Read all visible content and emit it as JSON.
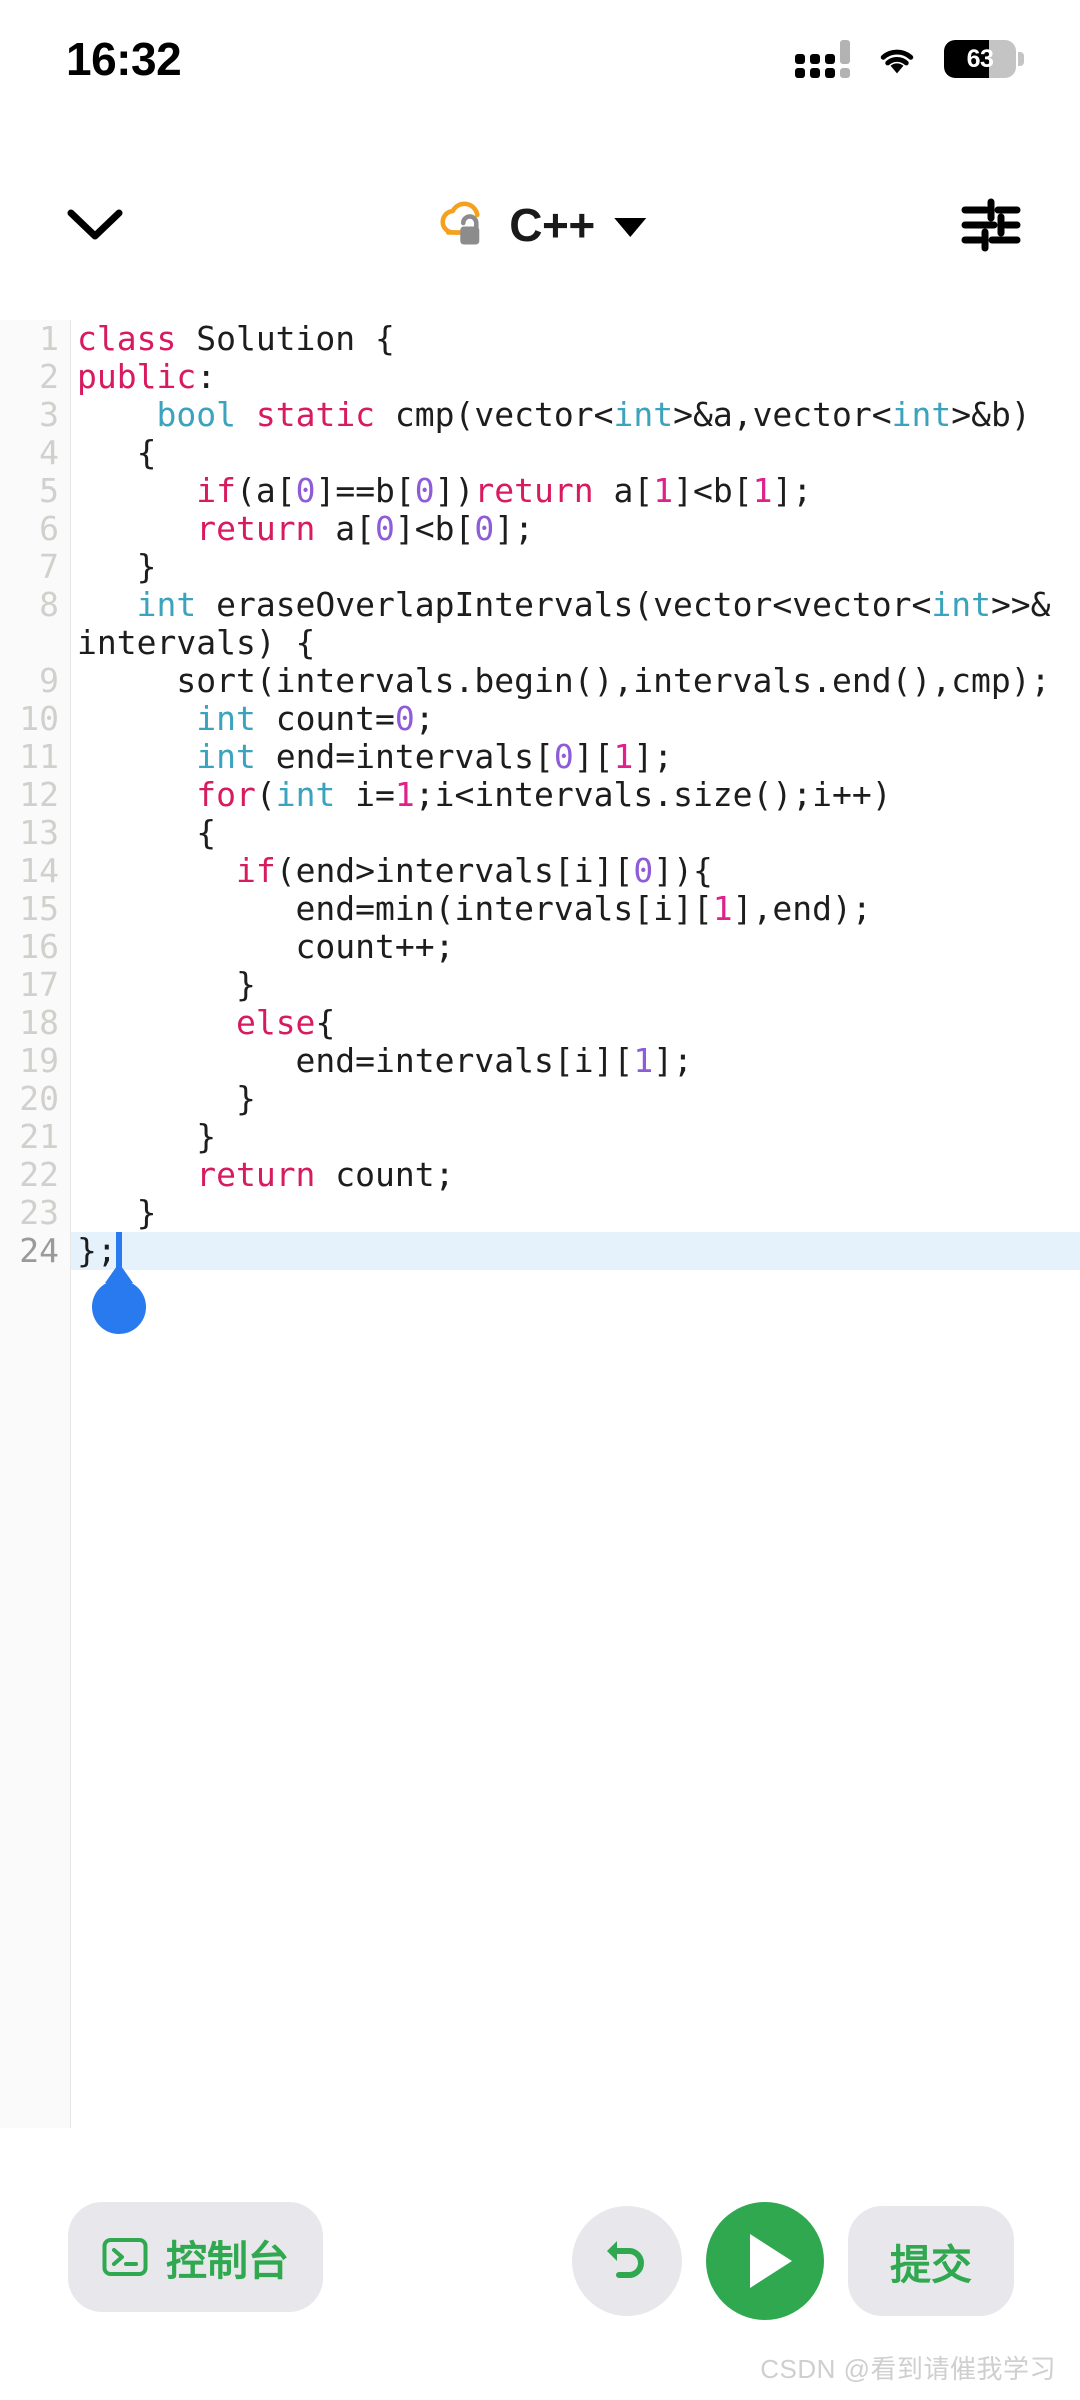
{
  "status_bar": {
    "time": "16:32",
    "signal_icon": "signal-bars-icon",
    "wifi_icon": "wifi-icon",
    "battery_icon": "battery-icon",
    "battery_percent": "63",
    "battery_level": 63
  },
  "app_bar": {
    "collapse_icon": "chevron-down-icon",
    "cloud_lock_icon": "cloud-lock-icon",
    "language": "C++",
    "language_caret_icon": "caret-down-icon",
    "settings_icon": "settings-sliders-icon",
    "cloud_color": "#f5a11f",
    "lock_color": "#8c8c8c"
  },
  "editor": {
    "active_line": 24,
    "total_lines": 24,
    "caret_line": 24,
    "caret_column": 3,
    "gutter_numbers": [
      "1",
      "2",
      "3",
      "4",
      "5",
      "6",
      "7",
      "8",
      "9",
      "10",
      "11",
      "12",
      "13",
      "14",
      "15",
      "16",
      "17",
      "18",
      "19",
      "20",
      "21",
      "22",
      "23",
      "24"
    ],
    "theme": {
      "keyword": "#d81b60",
      "type": "#3ba3bd",
      "number_purple": "#8e5cd9",
      "number_pink": "#e0218a",
      "plain": "#1d1d1d",
      "gutter_bg": "#fafafa",
      "active_line_bg": "#e6f2fb",
      "caret": "#2979ef"
    },
    "lines": [
      {
        "n": 1,
        "tokens": [
          {
            "t": "class",
            "c": "kw"
          },
          {
            "t": " Solution {",
            "c": "pl"
          }
        ]
      },
      {
        "n": 2,
        "tokens": [
          {
            "t": "public",
            "c": "kw"
          },
          {
            "t": ":",
            "c": "pl"
          }
        ]
      },
      {
        "n": 3,
        "tokens": [
          {
            "t": "    ",
            "c": "pl"
          },
          {
            "t": "bool",
            "c": "type"
          },
          {
            "t": " ",
            "c": "pl"
          },
          {
            "t": "static",
            "c": "kw"
          },
          {
            "t": " cmp(vector<",
            "c": "pl"
          },
          {
            "t": "int",
            "c": "type"
          },
          {
            "t": ">&a,vector<",
            "c": "pl"
          },
          {
            "t": "int",
            "c": "type"
          },
          {
            "t": ">&b)",
            "c": "pl"
          }
        ]
      },
      {
        "n": 4,
        "tokens": [
          {
            "t": "   {",
            "c": "pl"
          }
        ]
      },
      {
        "n": 5,
        "tokens": [
          {
            "t": "      ",
            "c": "pl"
          },
          {
            "t": "if",
            "c": "kw"
          },
          {
            "t": "(a[",
            "c": "pl"
          },
          {
            "t": "0",
            "c": "num0"
          },
          {
            "t": "]==b[",
            "c": "pl"
          },
          {
            "t": "0",
            "c": "num0"
          },
          {
            "t": "])",
            "c": "pl"
          },
          {
            "t": "return",
            "c": "kw"
          },
          {
            "t": " a[",
            "c": "pl"
          },
          {
            "t": "1",
            "c": "num1"
          },
          {
            "t": "]<b[",
            "c": "pl"
          },
          {
            "t": "1",
            "c": "num1"
          },
          {
            "t": "];",
            "c": "pl"
          }
        ]
      },
      {
        "n": 6,
        "tokens": [
          {
            "t": "      ",
            "c": "pl"
          },
          {
            "t": "return",
            "c": "kw"
          },
          {
            "t": " a[",
            "c": "pl"
          },
          {
            "t": "0",
            "c": "num0"
          },
          {
            "t": "]<b[",
            "c": "pl"
          },
          {
            "t": "0",
            "c": "num0"
          },
          {
            "t": "];",
            "c": "pl"
          }
        ]
      },
      {
        "n": 7,
        "tokens": [
          {
            "t": "   }",
            "c": "pl"
          }
        ]
      },
      {
        "n": 8,
        "tokens": [
          {
            "t": "   ",
            "c": "pl"
          },
          {
            "t": "int",
            "c": "type"
          },
          {
            "t": " eraseOverlapIntervals(vector<vector<",
            "c": "pl"
          },
          {
            "t": "int",
            "c": "type"
          },
          {
            "t": ">>& intervals) {",
            "c": "pl"
          }
        ]
      },
      {
        "n": 9,
        "tokens": [
          {
            "t": "     sort(intervals.begin(),intervals.end(),cmp);",
            "c": "pl"
          }
        ]
      },
      {
        "n": 10,
        "tokens": [
          {
            "t": "      ",
            "c": "pl"
          },
          {
            "t": "int",
            "c": "type"
          },
          {
            "t": " count=",
            "c": "pl"
          },
          {
            "t": "0",
            "c": "num0"
          },
          {
            "t": ";",
            "c": "pl"
          }
        ]
      },
      {
        "n": 11,
        "tokens": [
          {
            "t": "      ",
            "c": "pl"
          },
          {
            "t": "int",
            "c": "type"
          },
          {
            "t": " end=intervals[",
            "c": "pl"
          },
          {
            "t": "0",
            "c": "num0"
          },
          {
            "t": "][",
            "c": "pl"
          },
          {
            "t": "1",
            "c": "num1"
          },
          {
            "t": "];",
            "c": "pl"
          }
        ]
      },
      {
        "n": 12,
        "tokens": [
          {
            "t": "      ",
            "c": "pl"
          },
          {
            "t": "for",
            "c": "kw"
          },
          {
            "t": "(",
            "c": "pl"
          },
          {
            "t": "int",
            "c": "type"
          },
          {
            "t": " i=",
            "c": "pl"
          },
          {
            "t": "1",
            "c": "num1"
          },
          {
            "t": ";i<intervals.size();i++)",
            "c": "pl"
          }
        ]
      },
      {
        "n": 13,
        "tokens": [
          {
            "t": "      {",
            "c": "pl"
          }
        ]
      },
      {
        "n": 14,
        "tokens": [
          {
            "t": "        ",
            "c": "pl"
          },
          {
            "t": "if",
            "c": "kw"
          },
          {
            "t": "(end>intervals[i][",
            "c": "pl"
          },
          {
            "t": "0",
            "c": "num0"
          },
          {
            "t": "]){",
            "c": "pl"
          }
        ]
      },
      {
        "n": 15,
        "tokens": [
          {
            "t": "           end=min(intervals[i][",
            "c": "pl"
          },
          {
            "t": "1",
            "c": "num1"
          },
          {
            "t": "],end);",
            "c": "pl"
          }
        ]
      },
      {
        "n": 16,
        "tokens": [
          {
            "t": "           count++;",
            "c": "pl"
          }
        ]
      },
      {
        "n": 17,
        "tokens": [
          {
            "t": "        }",
            "c": "pl"
          }
        ]
      },
      {
        "n": 18,
        "tokens": [
          {
            "t": "        ",
            "c": "pl"
          },
          {
            "t": "else",
            "c": "kw"
          },
          {
            "t": "{",
            "c": "pl"
          }
        ]
      },
      {
        "n": 19,
        "tokens": [
          {
            "t": "           end=intervals[i][",
            "c": "pl"
          },
          {
            "t": "1",
            "c": "num0"
          },
          {
            "t": "];",
            "c": "pl"
          }
        ]
      },
      {
        "n": 20,
        "tokens": [
          {
            "t": "        }",
            "c": "pl"
          }
        ]
      },
      {
        "n": 21,
        "tokens": [
          {
            "t": "      }",
            "c": "pl"
          }
        ]
      },
      {
        "n": 22,
        "tokens": [
          {
            "t": "      ",
            "c": "pl"
          },
          {
            "t": "return",
            "c": "kw"
          },
          {
            "t": " count;",
            "c": "pl"
          }
        ]
      },
      {
        "n": 23,
        "tokens": [
          {
            "t": "   }",
            "c": "pl"
          }
        ]
      },
      {
        "n": 24,
        "tokens": [
          {
            "t": "};",
            "c": "pl"
          }
        ],
        "highlight": true
      }
    ]
  },
  "bottom_bar": {
    "console_label": "控制台",
    "console_icon": "terminal-icon",
    "undo_icon": "undo-arrow-icon",
    "run_icon": "play-icon",
    "submit_label": "提交",
    "accent_green": "#2fa84f",
    "button_bg": "#e8e8ec"
  },
  "watermark": {
    "text": "CSDN @看到请催我学习"
  }
}
